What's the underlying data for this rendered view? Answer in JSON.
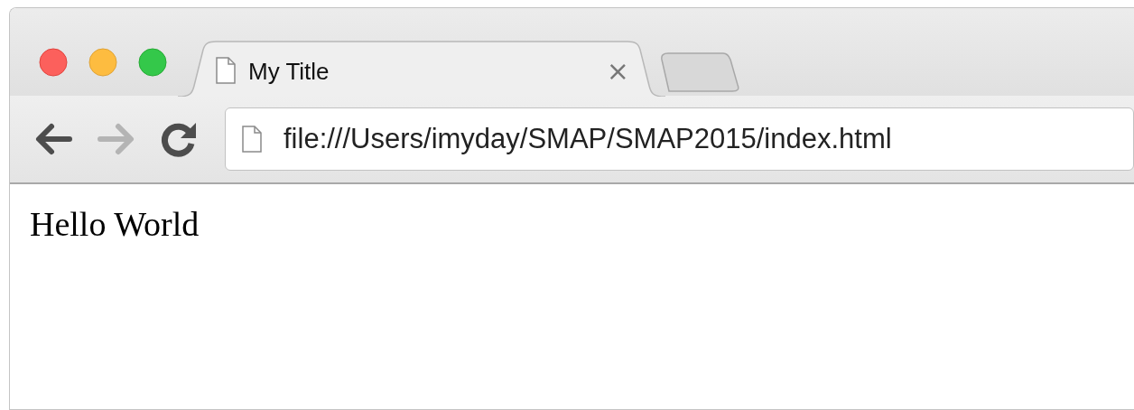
{
  "tabs": [
    {
      "title": "My Title",
      "close": "×",
      "selected": true
    }
  ],
  "toolbar": {
    "back": {
      "disabled": false
    },
    "forward": {
      "disabled": true
    },
    "address": "file:///Users/imyday/SMAP/SMAP2015/index.html"
  },
  "page": {
    "text": "Hello World"
  }
}
